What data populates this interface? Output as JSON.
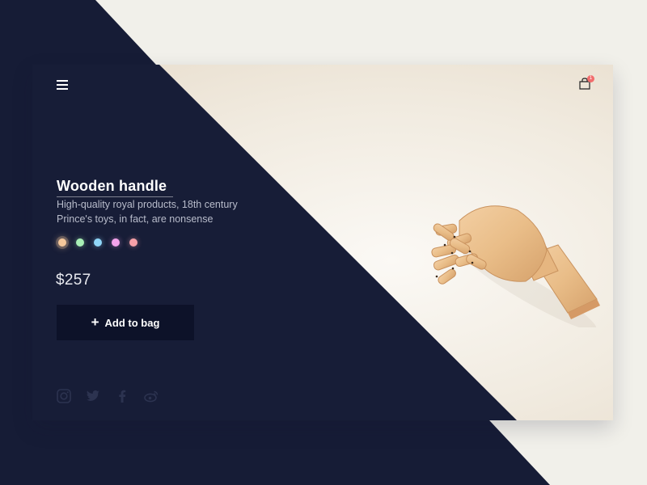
{
  "product": {
    "title": "Wooden handle",
    "description_line1": "High-quality royal products, 18th century",
    "description_line2": "Prince's toys, in fact, are nonsense",
    "price": "$257",
    "colors": [
      "#f4c79b",
      "#a8efb6",
      "#8fd6f8",
      "#f4a3ec",
      "#f7a1a8"
    ],
    "selected_color_index": 0
  },
  "cart": {
    "add_label": "Add to bag",
    "count": "1"
  },
  "social": [
    "instagram-icon",
    "twitter-icon",
    "facebook-icon",
    "weibo-icon"
  ],
  "theme": {
    "navy": "#161c36",
    "button": "#0d1229",
    "page_bg": "#f1f0ea",
    "badge": "#f26d6d"
  }
}
